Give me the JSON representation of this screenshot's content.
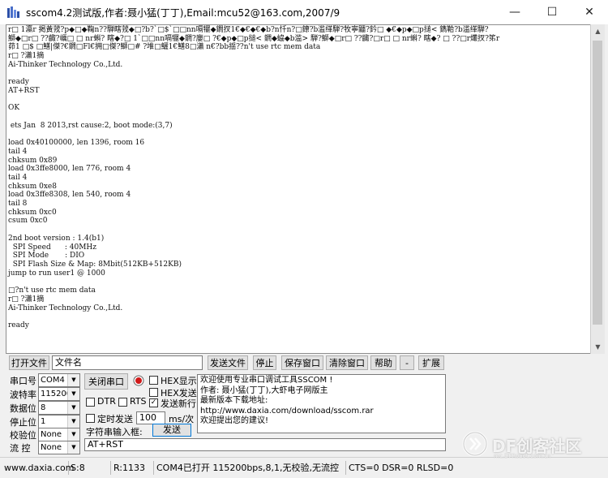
{
  "window": {
    "title": "sscom4.2测试版,作者:聂小猛(丁丁),Email:mcu52@163.com,2007/9",
    "minimize": "—",
    "maximize": "☐",
    "close": "✕"
  },
  "terminal": {
    "text": "r□ 1瀛r 掲黃茙?p◆□◆鞠n??騨瞎茙◆□?b?`□$`□□nn嗝犤◆鐧扠1€◆€◆€◆b?n忏n?□鐐?b滥缂騨?牧寧鼺?鈐□ ◆€◆p◆□p搥< 鐫鞈?b滥缂騨?\n鰤◆□r□ ??齱?巁□ □ nr蝌? 瞎◆?□ 1`□□nn嗝犤◆鐧?廮□ ?€◆p◆□p搥< 鐧◆蛠◆b滥> 騨?鰤◆□r□ ??齱?□r□ □ nr蝌? 瞎◆? □ ??□r爜扠?笫r\n茆1 □$ □鱔|傑?€鐧□Fl€拥□傑?鰤□# ?堆□鱺1€鱔8□瀟 n€?bb揺??n't use rtc mem data\nr□ ?瀟1摘\nAi-Thinker Technology Co.,Ltd.\n\nready\nAT+RST\n\nOK\n\n ets Jan  8 2013,rst cause:2, boot mode:(3,7)\n\nload 0x40100000, len 1396, room 16\ntail 4\nchksum 0x89\nload 0x3ffe8000, len 776, room 4\ntail 4\nchksum 0xe8\nload 0x3ffe8308, len 540, room 4\ntail 8\nchksum 0xc0\ncsum 0xc0\n\n2nd boot version : 1.4(b1)\n  SPI Speed      : 40MHz\n  SPI Mode       : DIO\n  SPI Flash Size & Map: 8Mbit(512KB+512KB)\njump to run user1 @ 1000\n\n□?n't use rtc mem data\nr□ ?瀟1摘\nAi-Thinker Technology Co.,Ltd.\n\nready"
  },
  "toolbar": {
    "open_file": "打开文件",
    "filename_value": "文件名",
    "send_file": "发送文件",
    "stop": "停止",
    "save_window": "保存窗口",
    "clear_window": "清除窗口",
    "help": "帮助",
    "minus": "-",
    "expand": "扩展"
  },
  "settings": {
    "port_label": "串口号",
    "port_value": "COM4",
    "baud_label": "波特率",
    "baud_value": "115200",
    "databits_label": "数据位",
    "databits_value": "8",
    "stopbits_label": "停止位",
    "stopbits_value": "1",
    "parity_label": "校验位",
    "parity_value": "None",
    "flow_label": "流 控",
    "flow_value": "None",
    "close_port": "关闭串口"
  },
  "options": {
    "hex_display": "HEX显示",
    "hex_send": "HEX发送",
    "dtr": "DTR",
    "rts": "RTS",
    "send_newline": "发送新行",
    "timed_send": "定时发送",
    "interval_value": "100",
    "interval_unit": "ms/次",
    "char_input": "字符串输入框:",
    "send_button": "发送",
    "input_value": "AT+RST"
  },
  "info": {
    "line1": "欢迎使用专业串口调试工具SSCOM !",
    "line2": "作者: 聂小猛(丁丁),大虾电子网版主",
    "line3": "最新版本下载地址:",
    "line4": "http://www.daxia.com/download/sscom.rar",
    "line5": "欢迎提出您的建议!"
  },
  "statusbar": {
    "website": "www.daxia.com",
    "sent": "S:8",
    "received": "R:1133",
    "port_status": "COM4已打开  115200bps,8,1,无校验,无流控",
    "signals": "CTS=0 DSR=0 RLSD=0"
  },
  "watermark": {
    "text": "DF创客社区",
    "sub": "mc.DFRobot.com.cn"
  },
  "colors": {
    "terminal_bg": "#ffffff",
    "window_bg": "#f0f0f0",
    "led_red": "#d11a1a"
  }
}
